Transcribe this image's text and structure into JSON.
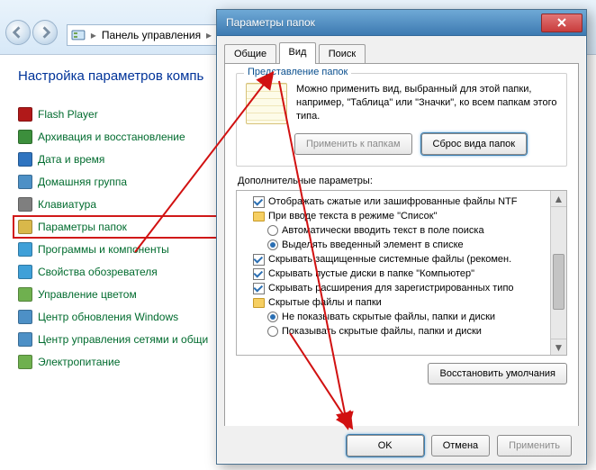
{
  "address_bar": {
    "text": "Панель управления"
  },
  "cp": {
    "heading": "Настройка параметров компь",
    "items": [
      {
        "label": "Flash Player",
        "color": "#b11919"
      },
      {
        "label": "Архивация и восстановление",
        "color": "#3c8f3c"
      },
      {
        "label": "Дата и время",
        "color": "#2f74c0"
      },
      {
        "label": "Домашняя группа",
        "color": "#4d90c6"
      },
      {
        "label": "Клавиатура",
        "color": "#7f7f7f"
      },
      {
        "label": "Параметры папок",
        "color": "#d9b84a"
      },
      {
        "label": "Программы и компоненты",
        "color": "#3fa0d8"
      },
      {
        "label": "Свойства обозревателя",
        "color": "#3fa0d8"
      },
      {
        "label": "Управление цветом",
        "color": "#6fb04f"
      },
      {
        "label": "Центр обновления Windows",
        "color": "#4d90c6"
      },
      {
        "label": "Центр управления сетями и общи",
        "color": "#4d90c6"
      },
      {
        "label": "Электропитание",
        "color": "#6fb04f"
      }
    ]
  },
  "dialog": {
    "title": "Параметры папок",
    "tabs": {
      "t0": "Общие",
      "t1": "Вид",
      "t2": "Поиск"
    },
    "group_rep_title": "Представление папок",
    "rep_text": "Можно применить вид, выбранный для этой папки, например, \"Таблица\" или \"Значки\", ко всем папкам этого типа.",
    "btn_apply_folders": "Применить к папкам",
    "btn_reset_folders": "Сброс вида папок",
    "adv_label": "Дополнительные параметры:",
    "tree": {
      "n0": "Отображать сжатые или зашифрованные файлы NTF",
      "n1": "При вводе текста в режиме \"Список\"",
      "n1a": "Автоматически вводить текст в поле поиска",
      "n1b": "Выделять введенный элемент в списке",
      "n2": "Скрывать защищенные системные файлы (рекомен.",
      "n3": "Скрывать пустые диски в папке \"Компьютер\"",
      "n4": "Скрывать расширения для зарегистрированных типо",
      "n5": "Скрытые файлы и папки",
      "n5a": "Не показывать скрытые файлы, папки и диски",
      "n5b": "Показывать скрытые файлы, папки и диски"
    },
    "btn_restore": "Восстановить умолчания",
    "btn_ok": "OK",
    "btn_cancel": "Отмена",
    "btn_apply": "Применить"
  }
}
